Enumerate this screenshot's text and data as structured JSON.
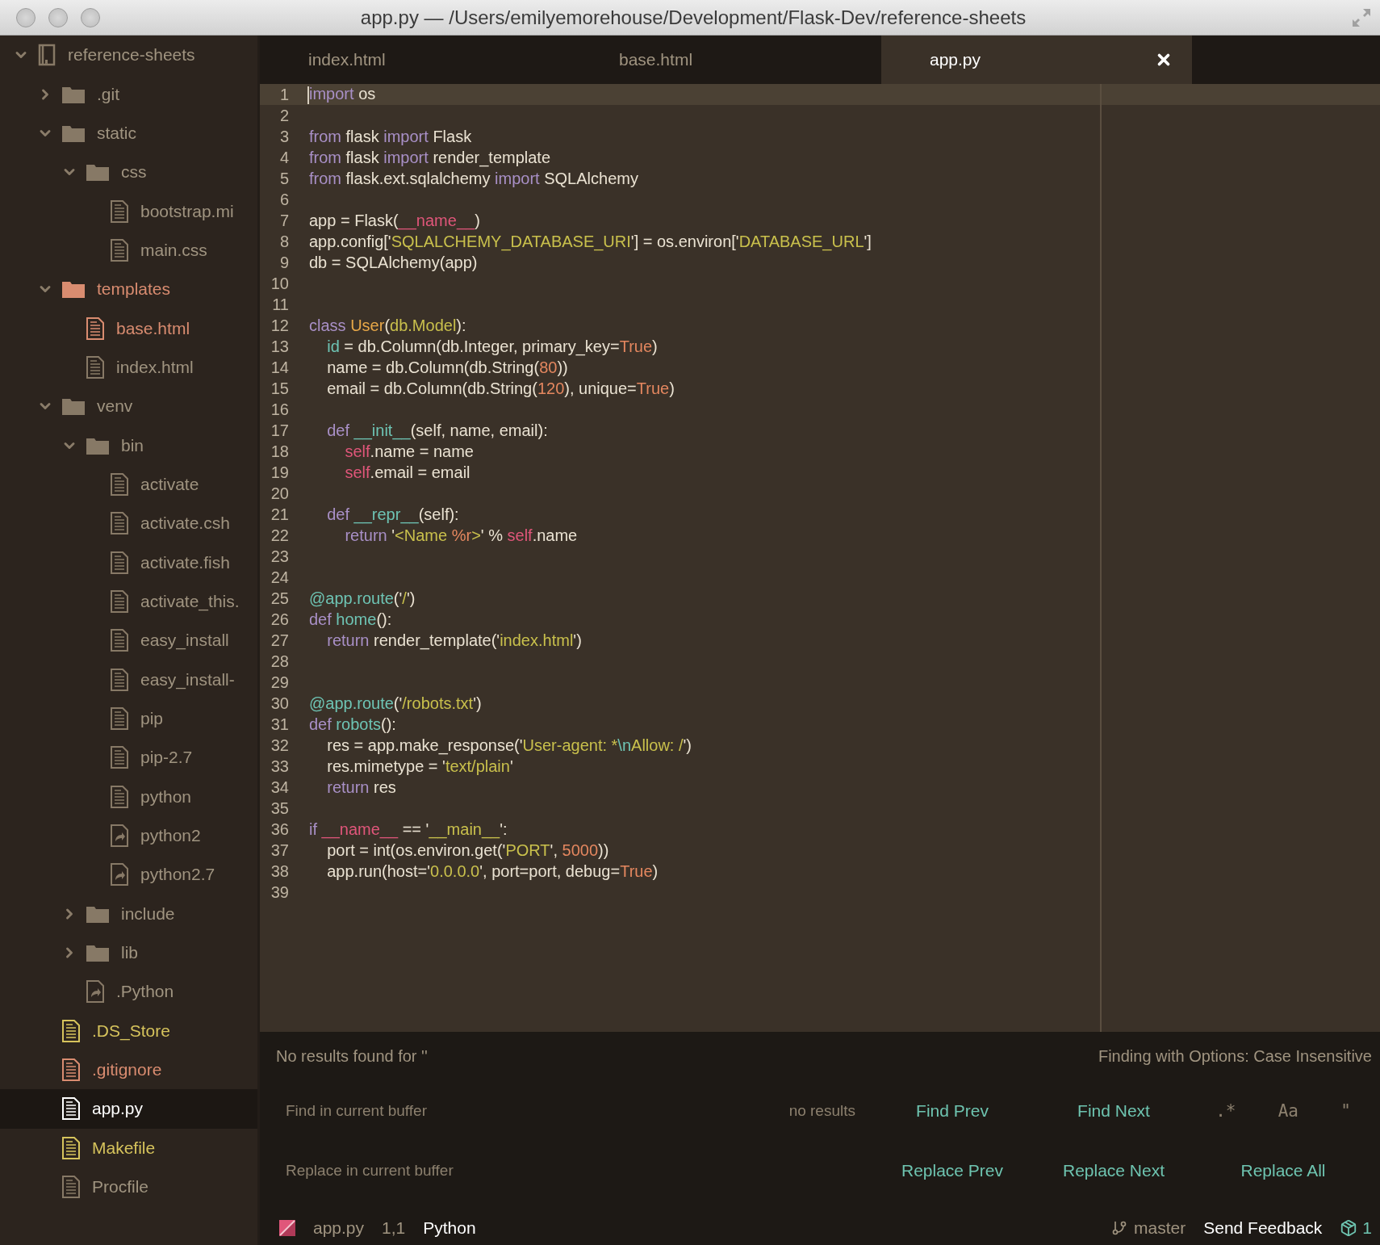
{
  "window": {
    "title": "app.py — /Users/emilyemorehouse/Development/Flask-Dev/reference-sheets"
  },
  "tree": {
    "name": "reference-sheets",
    "kind": "repo",
    "expanded": true,
    "selected": false,
    "children": [
      {
        "name": ".git",
        "kind": "folder",
        "expanded": false,
        "selected": false
      },
      {
        "name": "static",
        "kind": "folder",
        "expanded": true,
        "selected": false,
        "children": [
          {
            "name": "css",
            "kind": "folder",
            "expanded": true,
            "selected": false,
            "children": [
              {
                "name": "bootstrap.mi",
                "kind": "file",
                "selected": false
              },
              {
                "name": "main.css",
                "kind": "file",
                "selected": false
              }
            ]
          }
        ]
      },
      {
        "name": "templates",
        "kind": "folder",
        "expanded": true,
        "selected": false,
        "color": "#d98c70",
        "children": [
          {
            "name": "base.html",
            "kind": "file",
            "selected": false,
            "color": "#d98c70"
          },
          {
            "name": "index.html",
            "kind": "file",
            "selected": false
          }
        ]
      },
      {
        "name": "venv",
        "kind": "folder",
        "expanded": true,
        "selected": false,
        "children": [
          {
            "name": "bin",
            "kind": "folder",
            "expanded": true,
            "selected": false,
            "children": [
              {
                "name": "activate",
                "kind": "file",
                "selected": false
              },
              {
                "name": "activate.csh",
                "kind": "file",
                "selected": false
              },
              {
                "name": "activate.fish",
                "kind": "file",
                "selected": false
              },
              {
                "name": "activate_this.",
                "kind": "file",
                "selected": false
              },
              {
                "name": "easy_install",
                "kind": "file",
                "selected": false
              },
              {
                "name": "easy_install-",
                "kind": "file",
                "selected": false
              },
              {
                "name": "pip",
                "kind": "file",
                "selected": false
              },
              {
                "name": "pip-2.7",
                "kind": "file",
                "selected": false
              },
              {
                "name": "python",
                "kind": "file",
                "selected": false
              },
              {
                "name": "python2",
                "kind": "symlink",
                "selected": false
              },
              {
                "name": "python2.7",
                "kind": "symlink",
                "selected": false
              }
            ]
          },
          {
            "name": "include",
            "kind": "folder",
            "expanded": false,
            "selected": false
          },
          {
            "name": "lib",
            "kind": "folder",
            "expanded": false,
            "selected": false
          },
          {
            "name": ".Python",
            "kind": "symlink",
            "selected": false
          }
        ]
      },
      {
        "name": ".DS_Store",
        "kind": "file",
        "selected": false,
        "color": "#d6c35c"
      },
      {
        "name": ".gitignore",
        "kind": "file",
        "selected": false,
        "color": "#d98c70"
      },
      {
        "name": "app.py",
        "kind": "file",
        "selected": true
      },
      {
        "name": "Makefile",
        "kind": "file",
        "selected": false,
        "color": "#d6c35c"
      },
      {
        "name": "Procfile",
        "kind": "file",
        "selected": false
      }
    ]
  },
  "tabs": [
    {
      "label": "index.html",
      "selected": false
    },
    {
      "label": "base.html",
      "selected": false
    },
    {
      "label": "app.py",
      "selected": true
    }
  ],
  "code": [
    {
      "number": "1",
      "current": true,
      "tokens": [
        {
          "text": "import",
          "kind": "keyword"
        },
        {
          "text": " os",
          "kind": "plain"
        }
      ]
    },
    {
      "number": "2",
      "current": false
    },
    {
      "number": "3",
      "current": false,
      "tokens": [
        {
          "text": "from",
          "kind": "keyword"
        },
        {
          "text": " flask ",
          "kind": "plain"
        },
        {
          "text": "import",
          "kind": "keyword"
        },
        {
          "text": " Flask",
          "kind": "plain"
        }
      ]
    },
    {
      "number": "4",
      "current": false,
      "tokens": [
        {
          "text": "from",
          "kind": "keyword"
        },
        {
          "text": " flask ",
          "kind": "plain"
        },
        {
          "text": "import",
          "kind": "keyword"
        },
        {
          "text": " render_template",
          "kind": "plain"
        }
      ]
    },
    {
      "number": "5",
      "current": false,
      "tokens": [
        {
          "text": "from",
          "kind": "keyword"
        },
        {
          "text": " flask.ext.sqlalchemy ",
          "kind": "plain"
        },
        {
          "text": "import",
          "kind": "keyword"
        },
        {
          "text": " SQLAlchemy",
          "kind": "plain"
        }
      ]
    },
    {
      "number": "6",
      "current": false
    },
    {
      "number": "7",
      "current": false,
      "tokens": [
        {
          "text": "app = Flask(",
          "kind": "plain"
        },
        {
          "text": "__name__",
          "kind": "special"
        },
        {
          "text": ")",
          "kind": "plain"
        }
      ]
    },
    {
      "number": "8",
      "current": false,
      "tokens": [
        {
          "text": "app.config['",
          "kind": "plain"
        },
        {
          "text": "SQLALCHEMY_DATABASE_URI",
          "kind": "string"
        },
        {
          "text": "'] = os.environ['",
          "kind": "plain"
        },
        {
          "text": "DATABASE_URL",
          "kind": "string"
        },
        {
          "text": "']",
          "kind": "plain"
        }
      ]
    },
    {
      "number": "9",
      "current": false,
      "tokens": [
        {
          "text": "db = SQLAlchemy(app)",
          "kind": "plain"
        }
      ]
    },
    {
      "number": "10",
      "current": false
    },
    {
      "number": "11",
      "current": false
    },
    {
      "number": "12",
      "current": false,
      "tokens": [
        {
          "text": "class",
          "kind": "keyword"
        },
        {
          "text": " User",
          "kind": "classname"
        },
        {
          "text": "(",
          "kind": "plain"
        },
        {
          "text": "db.Model",
          "kind": "string"
        },
        {
          "text": "):",
          "kind": "plain"
        }
      ]
    },
    {
      "number": "13",
      "current": false,
      "tokens": [
        {
          "text": "    id",
          "kind": "function"
        },
        {
          "text": " = db.Column(db.Integer, primary_key=",
          "kind": "plain"
        },
        {
          "text": "True",
          "kind": "constant"
        },
        {
          "text": ")",
          "kind": "plain"
        }
      ]
    },
    {
      "number": "14",
      "current": false,
      "tokens": [
        {
          "text": "    name = db.Column(db.String(",
          "kind": "plain"
        },
        {
          "text": "80",
          "kind": "constant"
        },
        {
          "text": "))",
          "kind": "plain"
        }
      ]
    },
    {
      "number": "15",
      "current": false,
      "tokens": [
        {
          "text": "    email = db.Column(db.String(",
          "kind": "plain"
        },
        {
          "text": "120",
          "kind": "constant"
        },
        {
          "text": "), unique=",
          "kind": "plain"
        },
        {
          "text": "True",
          "kind": "constant"
        },
        {
          "text": ")",
          "kind": "plain"
        }
      ]
    },
    {
      "number": "16",
      "current": false
    },
    {
      "number": "17",
      "current": false,
      "tokens": [
        {
          "text": "    def",
          "kind": "keyword"
        },
        {
          "text": " __init__",
          "kind": "function"
        },
        {
          "text": "(self, name, email):",
          "kind": "plain"
        }
      ]
    },
    {
      "number": "18",
      "current": false,
      "tokens": [
        {
          "text": "        self",
          "kind": "special"
        },
        {
          "text": ".name = name",
          "kind": "plain"
        }
      ]
    },
    {
      "number": "19",
      "current": false,
      "tokens": [
        {
          "text": "        self",
          "kind": "special"
        },
        {
          "text": ".email = email",
          "kind": "plain"
        }
      ]
    },
    {
      "number": "20",
      "current": false
    },
    {
      "number": "21",
      "current": false,
      "tokens": [
        {
          "text": "    def",
          "kind": "keyword"
        },
        {
          "text": " __repr__",
          "kind": "function"
        },
        {
          "text": "(self):",
          "kind": "plain"
        }
      ]
    },
    {
      "number": "22",
      "current": false,
      "tokens": [
        {
          "text": "        return",
          "kind": "keyword"
        },
        {
          "text": " '",
          "kind": "plain"
        },
        {
          "text": "<Name ",
          "kind": "string"
        },
        {
          "text": "%r",
          "kind": "constant"
        },
        {
          "text": ">",
          "kind": "string"
        },
        {
          "text": "' % ",
          "kind": "plain"
        },
        {
          "text": "self",
          "kind": "special"
        },
        {
          "text": ".name",
          "kind": "plain"
        }
      ]
    },
    {
      "number": "23",
      "current": false
    },
    {
      "number": "24",
      "current": false
    },
    {
      "number": "25",
      "current": false,
      "tokens": [
        {
          "text": "@app.route",
          "kind": "function"
        },
        {
          "text": "('",
          "kind": "plain"
        },
        {
          "text": "/",
          "kind": "string"
        },
        {
          "text": "')",
          "kind": "plain"
        }
      ]
    },
    {
      "number": "26",
      "current": false,
      "tokens": [
        {
          "text": "def",
          "kind": "keyword"
        },
        {
          "text": " home",
          "kind": "function"
        },
        {
          "text": "():",
          "kind": "plain"
        }
      ]
    },
    {
      "number": "27",
      "current": false,
      "tokens": [
        {
          "text": "    return",
          "kind": "keyword"
        },
        {
          "text": " render_template('",
          "kind": "plain"
        },
        {
          "text": "index.html",
          "kind": "string"
        },
        {
          "text": "')",
          "kind": "plain"
        }
      ]
    },
    {
      "number": "28",
      "current": false
    },
    {
      "number": "29",
      "current": false
    },
    {
      "number": "30",
      "current": false,
      "tokens": [
        {
          "text": "@app.route",
          "kind": "function"
        },
        {
          "text": "('",
          "kind": "plain"
        },
        {
          "text": "/robots.txt",
          "kind": "string"
        },
        {
          "text": "')",
          "kind": "plain"
        }
      ]
    },
    {
      "number": "31",
      "current": false,
      "tokens": [
        {
          "text": "def",
          "kind": "keyword"
        },
        {
          "text": " robots",
          "kind": "function"
        },
        {
          "text": "():",
          "kind": "plain"
        }
      ]
    },
    {
      "number": "32",
      "current": false,
      "tokens": [
        {
          "text": "    res = app.make_response('",
          "kind": "plain"
        },
        {
          "text": "User-agent: *",
          "kind": "string"
        },
        {
          "text": "\\n",
          "kind": "function"
        },
        {
          "text": "Allow: /",
          "kind": "string"
        },
        {
          "text": "')",
          "kind": "plain"
        }
      ]
    },
    {
      "number": "33",
      "current": false,
      "tokens": [
        {
          "text": "    res.mimetype = '",
          "kind": "plain"
        },
        {
          "text": "text/plain",
          "kind": "string"
        },
        {
          "text": "'",
          "kind": "plain"
        }
      ]
    },
    {
      "number": "34",
      "current": false,
      "tokens": [
        {
          "text": "    return",
          "kind": "keyword"
        },
        {
          "text": " res",
          "kind": "plain"
        }
      ]
    },
    {
      "number": "35",
      "current": false
    },
    {
      "number": "36",
      "current": false,
      "tokens": [
        {
          "text": "if",
          "kind": "keyword"
        },
        {
          "text": " __name__",
          "kind": "special"
        },
        {
          "text": " == '",
          "kind": "plain"
        },
        {
          "text": "__main__",
          "kind": "string"
        },
        {
          "text": "':",
          "kind": "plain"
        }
      ]
    },
    {
      "number": "37",
      "current": false,
      "tokens": [
        {
          "text": "    port = int(os.environ.get('",
          "kind": "plain"
        },
        {
          "text": "PORT",
          "kind": "string"
        },
        {
          "text": "', ",
          "kind": "plain"
        },
        {
          "text": "5000",
          "kind": "constant"
        },
        {
          "text": "))",
          "kind": "plain"
        }
      ]
    },
    {
      "number": "38",
      "current": false,
      "tokens": [
        {
          "text": "    app.run(host='",
          "kind": "plain"
        },
        {
          "text": "0.0.0.0",
          "kind": "string"
        },
        {
          "text": "', port=port, debug=",
          "kind": "plain"
        },
        {
          "text": "True",
          "kind": "constant"
        },
        {
          "text": ")",
          "kind": "plain"
        }
      ]
    },
    {
      "number": "39",
      "current": false
    }
  ],
  "find_panel": {
    "message": "No results found for ''",
    "options_summary": "Finding with Options: Case Insensitive",
    "find_field": {
      "placeholder": "Find in current buffer",
      "result": "no results"
    },
    "find_buttons": [
      "Find Prev",
      "Find Next"
    ],
    "option_buttons": [
      {
        "label": ".*",
        "selected": false
      },
      {
        "label": "Aa",
        "selected": false
      },
      {
        "label": "\"",
        "selected": false
      }
    ],
    "replace_field": {
      "placeholder": "Replace in current buffer"
    },
    "replace_buttons": [
      "Replace Prev",
      "Replace Next",
      "Replace All"
    ]
  },
  "status_bar": {
    "file_name": "app.py",
    "cursor": "1,1",
    "grammar": "Python",
    "branch": "master",
    "feedback": "Send Feedback",
    "updates": "1"
  }
}
